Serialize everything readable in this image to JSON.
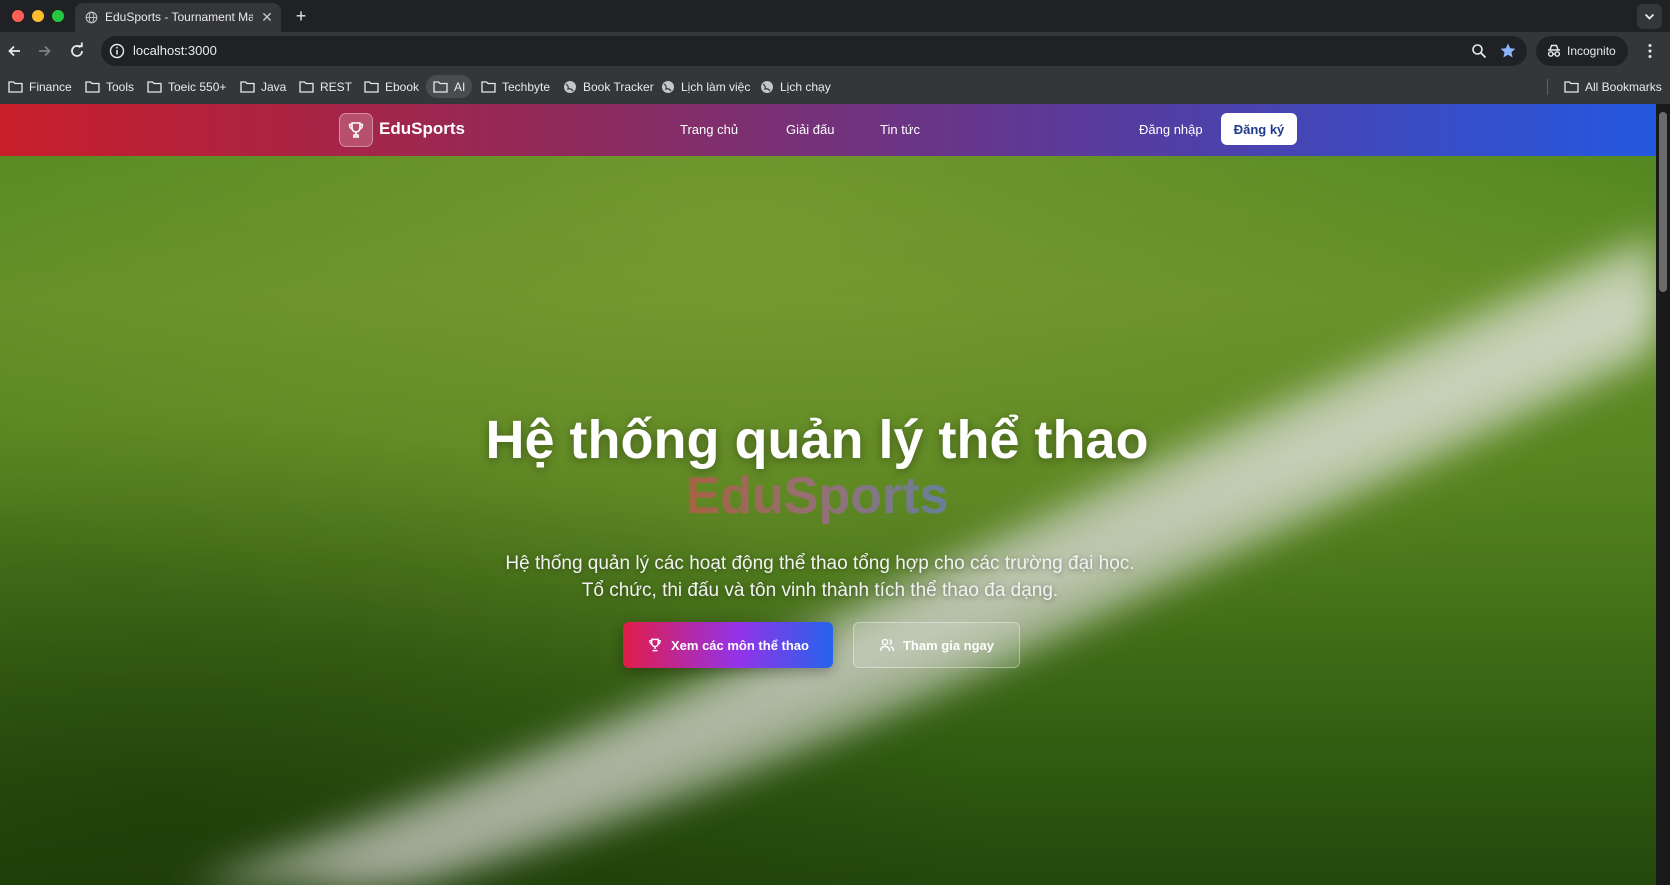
{
  "browser": {
    "tab_title": "EduSports - Tournament Management",
    "url": "localhost:3000",
    "incognito_label": "Incognito",
    "bookmarks": [
      {
        "label": "Finance",
        "icon": "folder-icon"
      },
      {
        "label": "Tools",
        "icon": "folder-icon"
      },
      {
        "label": "Toeic 550+",
        "icon": "folder-icon"
      },
      {
        "label": "Java",
        "icon": "folder-icon"
      },
      {
        "label": "REST",
        "icon": "folder-icon"
      },
      {
        "label": "Ebook",
        "icon": "folder-icon"
      },
      {
        "label": "AI",
        "icon": "folder-icon"
      },
      {
        "label": "Techbyte",
        "icon": "folder-icon"
      },
      {
        "label": "Book Tracker",
        "icon": "globe-icon"
      },
      {
        "label": "Lịch làm việc",
        "icon": "globe-icon"
      },
      {
        "label": "Lịch chạy",
        "icon": "globe-icon"
      }
    ],
    "all_bookmarks_label": "All Bookmarks"
  },
  "site": {
    "brand": "EduSports",
    "nav": {
      "home": "Trang chủ",
      "tournaments": "Giải đấu",
      "news": "Tin tức"
    },
    "login_label": "Đăng nhập",
    "register_label": "Đăng ký"
  },
  "hero": {
    "title": "Hệ thống quản lý thể thao",
    "brand": "EduSports",
    "subtitle": "Hệ thống quản lý các hoạt động thể thao tổng hợp cho các trường đại học. Tổ chức, thi đấu và tôn vinh thành tích thể thao đa dạng.",
    "primary_button": "Xem các môn thể thao",
    "secondary_button": "Tham gia ngay"
  },
  "colors": {
    "nav_gradient": [
      "#c81e2a",
      "#2458e0"
    ],
    "primary_button_gradient": [
      "#e11d48",
      "#9333ea",
      "#2563eb"
    ],
    "register_text": "#1e3a8a"
  }
}
